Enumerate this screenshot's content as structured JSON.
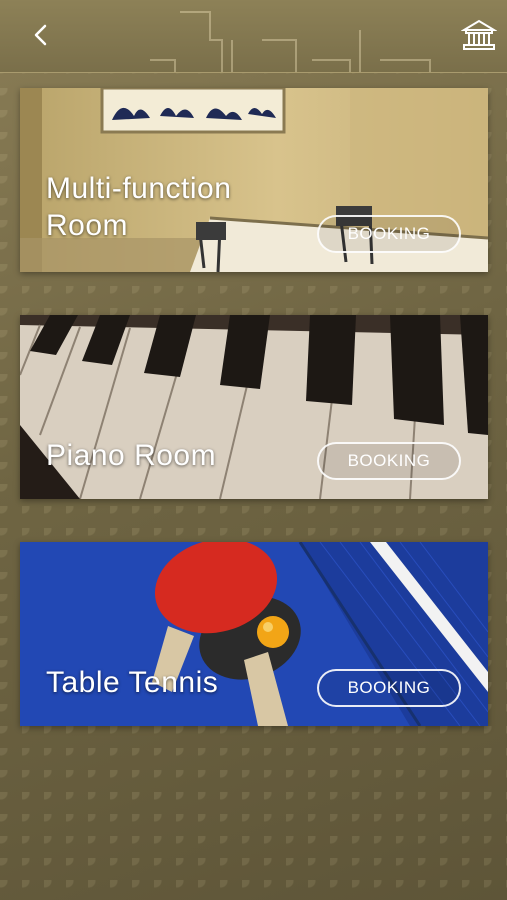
{
  "header": {
    "back_icon": "chevron-left-icon",
    "home_icon": "building-icon"
  },
  "facilities": [
    {
      "title": "Multi-function Room",
      "booking_label": "BOOKING"
    },
    {
      "title": "Piano Room",
      "booking_label": "BOOKING"
    },
    {
      "title": "Table Tennis",
      "booking_label": "BOOKING"
    }
  ]
}
